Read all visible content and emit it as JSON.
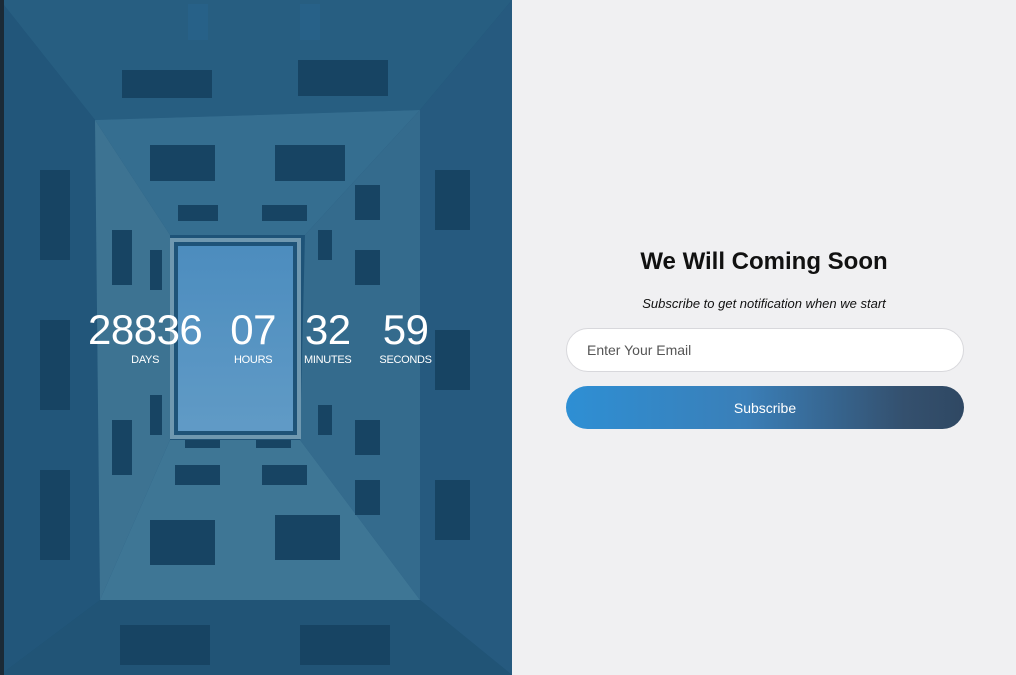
{
  "countdown": {
    "days": {
      "value": "28836",
      "label": "DAYS"
    },
    "hours": {
      "value": "07",
      "label": "HOURS"
    },
    "minutes": {
      "value": "32",
      "label": "MINUTES"
    },
    "seconds": {
      "value": "59",
      "label": "SECONDS"
    }
  },
  "signup": {
    "title": "We Will Coming Soon",
    "subtitle": "Subscribe to get notification when we start",
    "email_placeholder": "Enter Your Email",
    "button_label": "Subscribe"
  },
  "colors": {
    "overlay": "#1d4f72",
    "button_gradient_start": "#2e8fd4",
    "button_gradient_end": "#2f4863",
    "right_background": "#f0f0f2"
  }
}
